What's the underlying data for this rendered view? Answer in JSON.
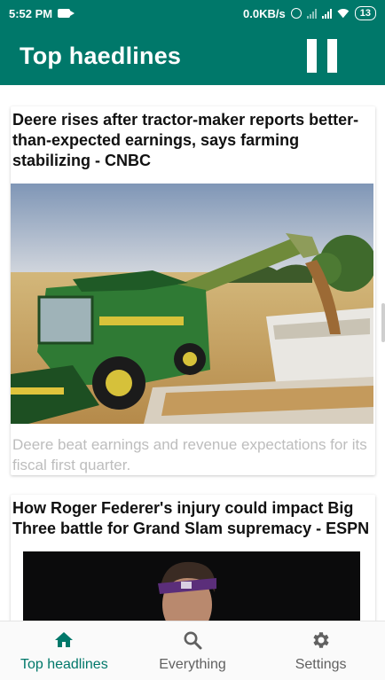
{
  "status_bar": {
    "time": "5:52 PM",
    "network_speed": "0.0KB/s",
    "battery": "13"
  },
  "app_bar": {
    "title": "Top haedlines",
    "pause_icon": "pause-icon"
  },
  "articles": [
    {
      "title": "Deere rises after tractor-maker reports better-than-expected earnings, says farming stabilizing - CNBC",
      "description": "Deere beat earnings and revenue expectations for its fiscal first quarter.",
      "image": "tractor-harvester-photo"
    },
    {
      "title": "How Roger Federer's injury could impact Big Three battle for Grand Slam supremacy - ESPN",
      "image": "tennis-player-photo"
    }
  ],
  "bottom_nav": {
    "items": [
      {
        "label": "Top headlines",
        "icon": "home-icon",
        "active": true
      },
      {
        "label": "Everything",
        "icon": "search-icon",
        "active": false
      },
      {
        "label": "Settings",
        "icon": "gear-icon",
        "active": false
      }
    ]
  },
  "colors": {
    "primary": "#00786a",
    "description_text": "#bdbdbd",
    "nav_inactive": "#616161"
  }
}
